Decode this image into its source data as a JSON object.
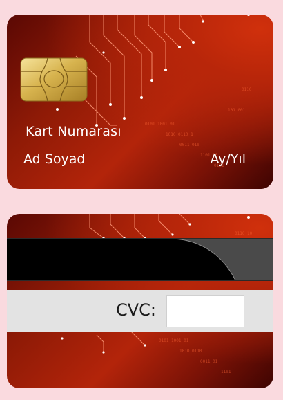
{
  "card_front": {
    "number_label": "Kart Numarası",
    "name_label": "Ad Soyad",
    "expiry_label": "Ay/Yıl"
  },
  "card_back": {
    "cvc_label": "CVC:",
    "cvc_value": ""
  },
  "colors": {
    "page_background": "#fadadf",
    "card_red": "#b3240a",
    "card_dark": "#3e0402",
    "magstripe": "#000000",
    "signature_strip": "#e3e3e3"
  },
  "icons": {
    "chip": "emv-chip-icon"
  }
}
